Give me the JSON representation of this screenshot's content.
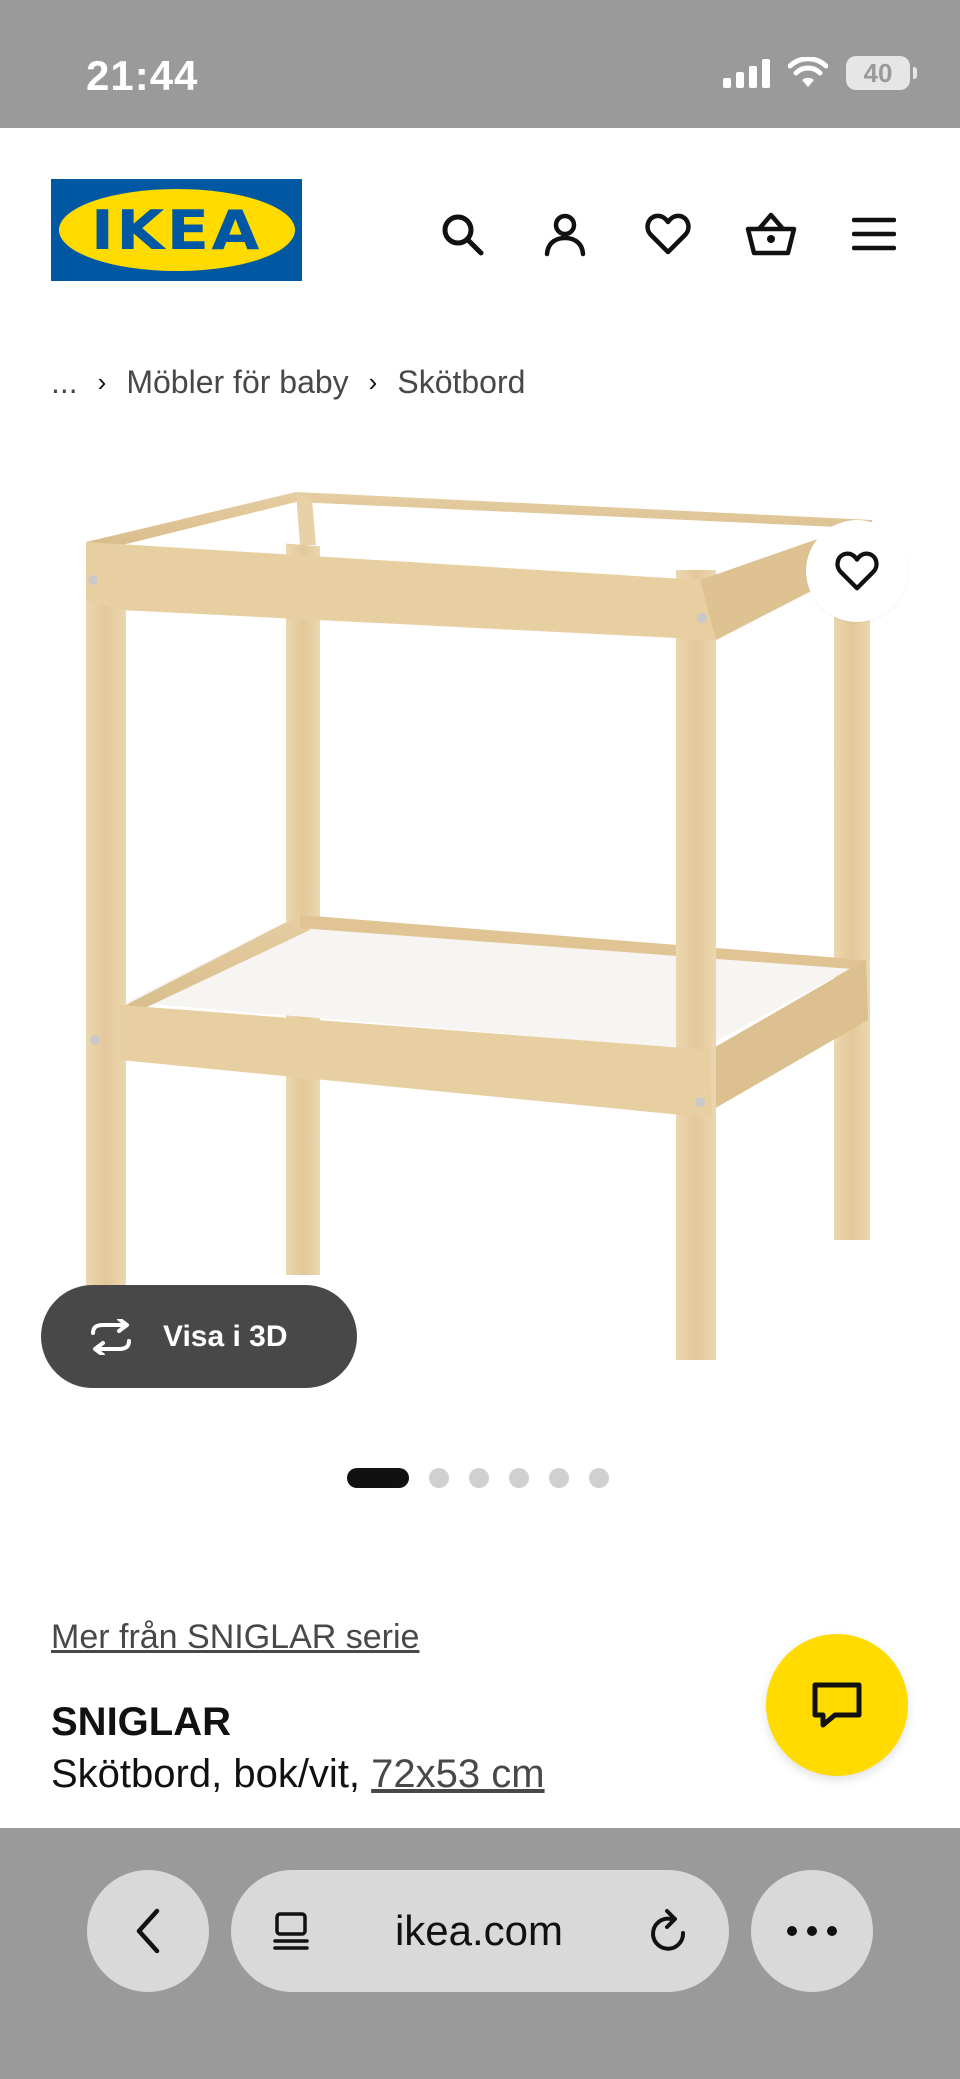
{
  "status_bar": {
    "time": "21:44",
    "battery": "40",
    "icons": [
      "signal-icon",
      "wifi-icon",
      "battery-icon"
    ]
  },
  "header": {
    "logo_text": "IKEA",
    "icons": [
      "search-icon",
      "account-icon",
      "heart-icon",
      "basket-icon",
      "menu-icon"
    ]
  },
  "breadcrumb": {
    "ellipsis": "...",
    "items": [
      "Möbler för baby",
      "Skötbord"
    ]
  },
  "product_image": {
    "view_3d_label": "Visa i 3D",
    "carousel_count": 6,
    "carousel_active_index": 0
  },
  "product": {
    "series_link": "Mer från SNIGLAR serie",
    "name": "SNIGLAR",
    "description_prefix": "Skötbord, bok/vit, ",
    "size": "72x53 cm"
  },
  "browser": {
    "url": "ikea.com"
  },
  "colors": {
    "ikea_blue": "#0058a3",
    "ikea_yellow": "#ffdb00",
    "chrome_gray": "#9a9a9a",
    "pill_gray": "#d9d9d9",
    "wood": "#e8d1a6"
  }
}
